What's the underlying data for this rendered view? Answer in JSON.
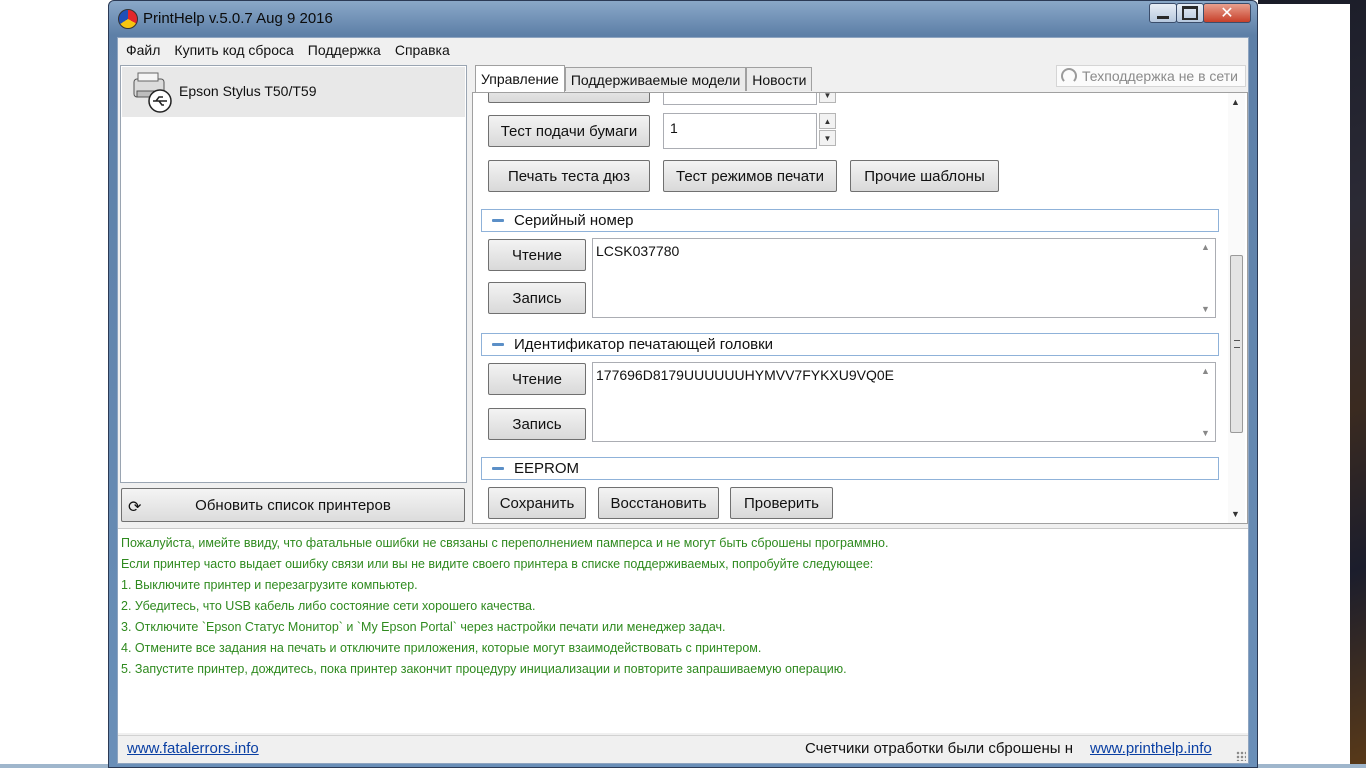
{
  "window": {
    "title": "PrintHelp v.5.0.7 Aug  9 2016"
  },
  "menu": [
    "Файл",
    "Купить код сброса",
    "Поддержка",
    "Справка"
  ],
  "printers": [
    {
      "name": "Epson Stylus T50/T59"
    }
  ],
  "refresh_label": "Обновить список принтеров",
  "tabs": [
    "Управление",
    "Поддерживаемые модели",
    "Новости"
  ],
  "support_status": "Техподдержка не в сети",
  "control": {
    "paper_feed_button": "Тест подачи бумаги",
    "paper_feed_value": "1",
    "nozzle_check_button": "Печать теста дюз",
    "print_modes_button": "Тест режимов печати",
    "other_templates_button": "Прочие шаблоны",
    "serial": {
      "title": "Серийный номер",
      "read": "Чтение",
      "write": "Запись",
      "value": "LCSK037780"
    },
    "head_id": {
      "title": "Идентификатор печатающей головки",
      "read": "Чтение",
      "write": "Запись",
      "value": "177696D8179UUUUUUHYMVV7FYKXU9VQ0E"
    },
    "eeprom": {
      "title": "EEPROM",
      "save": "Сохранить",
      "restore": "Восстановить",
      "verify": "Проверить"
    }
  },
  "log": [
    "Пожалуйста, имейте ввиду, что фатальные ошибки не связаны с переполнением памперса и не могут быть сброшены программно.",
    "Если принтер часто выдает ошибку связи или вы не видите своего принтера в списке поддерживаемых, попробуйте следующее:",
    "1. Выключите принтер и перезагрузите компьютер.",
    "2. Убедитесь, что USB кабель либо состояние сети хорошего качества.",
    "3. Отключите `Epson Статус Монитор` и `My Epson Portal` через настройки печати или менеджер задач.",
    "4. Отмените все задания на печать и отключите приложения, которые могут взаимодействовать с принтером.",
    "5. Запустите принтер, дождитесь, пока принтер закончит процедуру инициализации и повторите запрашиваемую операцию."
  ],
  "status": {
    "left_link": "www.fatalerrors.info",
    "message": "Счетчики отработки были сброшены н",
    "right_link": "www.printhelp.info"
  },
  "colors": {
    "log_text": "#2f8a1f",
    "link": "#0a3fa3",
    "section_border": "#8fb2d9"
  }
}
